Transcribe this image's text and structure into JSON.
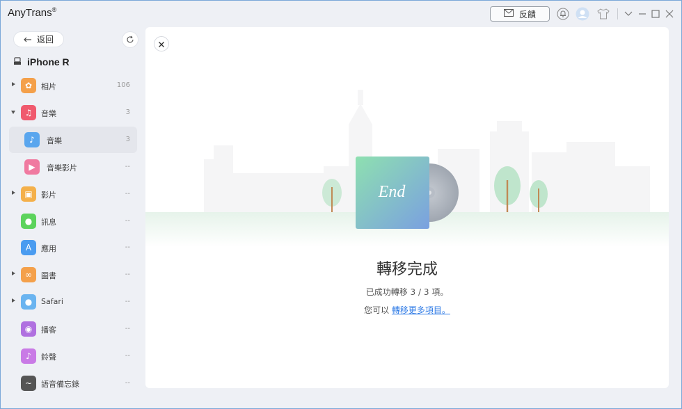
{
  "window": {
    "app_title": "AnyTrans",
    "app_mark": "®",
    "feedback_label": "反饋"
  },
  "sidebar": {
    "back_label": "返回",
    "device_name": "iPhone R",
    "items": [
      {
        "label": "相片",
        "count": "106",
        "icon": "photos-icon",
        "expander": "right",
        "color": "#f4a04a"
      },
      {
        "label": "音樂",
        "count": "3",
        "icon": "music-icon",
        "expander": "down",
        "color": "#f05a6e"
      },
      {
        "label": "音樂",
        "count": "3",
        "icon": "music-note-icon",
        "expander": "none",
        "color": "#5aa6ee",
        "sub": true,
        "active": true
      },
      {
        "label": "音樂影片",
        "count": "--",
        "icon": "music-video-icon",
        "expander": "none",
        "color": "#f07aa0",
        "sub": true
      },
      {
        "label": "影片",
        "count": "--",
        "icon": "videos-icon",
        "expander": "right",
        "color": "#f4b04a"
      },
      {
        "label": "訊息",
        "count": "--",
        "icon": "messages-icon",
        "expander": "none",
        "color": "#5cd35c"
      },
      {
        "label": "應用",
        "count": "--",
        "icon": "app-store-icon",
        "expander": "none",
        "color": "#4a9cf0"
      },
      {
        "label": "圖書",
        "count": "--",
        "icon": "books-icon",
        "expander": "right",
        "color": "#f4a04a"
      },
      {
        "label": "Safari",
        "count": "--",
        "icon": "safari-icon",
        "expander": "right",
        "color": "#6ab4f0"
      },
      {
        "label": "播客",
        "count": "--",
        "icon": "podcasts-icon",
        "expander": "none",
        "color": "#b070e0"
      },
      {
        "label": "鈴聲",
        "count": "--",
        "icon": "ringtones-icon",
        "expander": "none",
        "color": "#c97ae6"
      },
      {
        "label": "語音備忘錄",
        "count": "--",
        "icon": "voice-memos-icon",
        "expander": "none",
        "color": "#555555"
      }
    ]
  },
  "main": {
    "album_text": "End",
    "title": "轉移完成",
    "subtitle": "已成功轉移 3 / 3 項。",
    "more_prefix": "您可以",
    "more_link": "轉移更多項目。"
  },
  "colors": {
    "accent": "#2f7be6",
    "album_start": "#8ee0b0",
    "album_end": "#7aa6e0",
    "tree": "#a8dcc0"
  }
}
